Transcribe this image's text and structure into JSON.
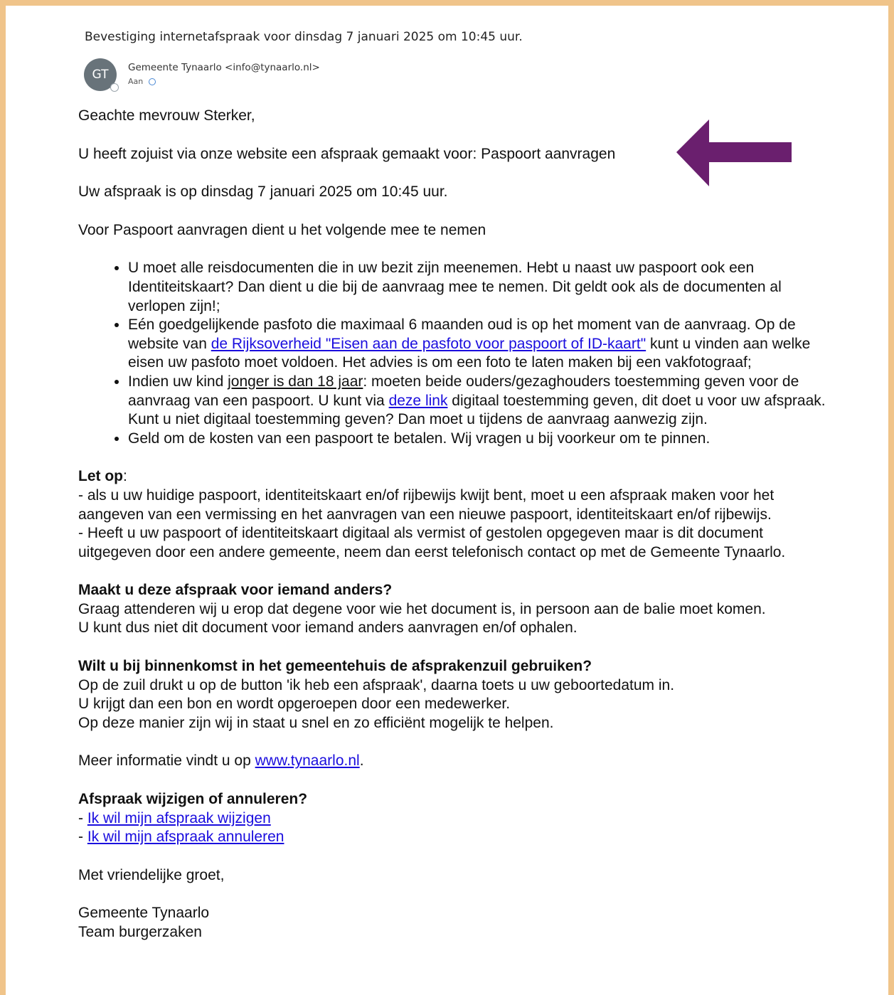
{
  "email": {
    "subject": "Bevestiging internetafspraak voor dinsdag 7 januari 2025 om 10:45 uur.",
    "sender": {
      "initials": "GT",
      "display": "Gemeente Tynaarlo <info@tynaarlo.nl>"
    },
    "to_label": "Aan"
  },
  "body": {
    "salutation": "Geachte mevrouw Sterker,",
    "intro": "U heeft zojuist via onze website een afspraak gemaakt voor: Paspoort aanvragen",
    "appointment": "Uw afspraak is op dinsdag 7 januari 2025 om 10:45 uur.",
    "bring_intro": "Voor Paspoort aanvragen dient u het volgende mee te nemen",
    "bullet1": "U moet alle reisdocumenten die in uw bezit zijn meenemen. Hebt u naast uw paspoort ook een Identiteitskaart? Dan dient u die bij de aanvraag mee te nemen. Dit geldt ook als de documenten al verlopen zijn!;",
    "bullet2_a": "Eén goedgelijkende pasfoto die maximaal 6 maanden oud is op het moment van de aanvraag. Op de website van ",
    "bullet2_link": "de Rijksoverheid \"Eisen aan de pasfoto voor paspoort of ID-kaart\"",
    "bullet2_b": " kunt u vinden aan welke eisen uw pasfoto moet voldoen. Het advies is om een foto te laten maken bij een vakfotograaf;",
    "bullet3_a": "Indien uw kind ",
    "bullet3_u": "jonger is dan 18 jaar",
    "bullet3_b": ": moeten beide ouders/gezaghouders toestemming geven voor de aanvraag van een paspoort. U kunt via ",
    "bullet3_link": "deze link",
    "bullet3_c": " digitaal toestemming geven, dit doet u voor uw afspraak. Kunt u niet digitaal toestemming geven? Dan moet u tijdens de aanvraag aanwezig zijn.",
    "bullet4": "Geld om de kosten van een paspoort te betalen. Wij vragen u bij voorkeur om  te pinnen.",
    "letop_heading": "Let op",
    "letop_colon": ":",
    "letop_1": "- als u uw huidige paspoort, identiteitskaart en/of rijbewijs kwijt bent, moet u een afspraak maken voor het aangeven van een vermissing en het aanvragen van een nieuwe paspoort, identiteitskaart en/of rijbewijs.",
    "letop_2": "- Heeft u uw paspoort of identiteitskaart digitaal als vermist of gestolen opgegeven maar is dit document uitgegeven door een andere gemeente, neem dan eerst telefonisch contact op met de Gemeente Tynaarlo.",
    "other_heading": "Maakt u deze afspraak voor iemand anders?",
    "other_1": "Graag attenderen wij u erop dat degene voor wie het document is, in persoon aan de balie moet komen.",
    "other_2": "U kunt dus niet dit document voor iemand anders aanvragen en/of ophalen.",
    "kiosk_heading": "Wilt u bij binnenkomst in het gemeentehuis de afsprakenzuil gebruiken?",
    "kiosk_1": "Op de zuil drukt u op de button 'ik heb een afspraak', daarna toets u uw geboortedatum in.",
    "kiosk_2": "U krijgt dan een bon en wordt opgeroepen door een medewerker.",
    "kiosk_3": "Op deze manier zijn wij in staat u snel en zo efficiënt mogelijk te helpen.",
    "more_info_a": "Meer informatie vindt u op ",
    "more_info_link": "www.tynaarlo.nl",
    "more_info_b": ".",
    "change_heading": "Afspraak wijzigen of annuleren?",
    "change_prefix": "- ",
    "change_link": "Ik wil mijn afspraak wijzigen",
    "cancel_link": "Ik wil mijn afspraak annuleren",
    "closing": "Met vriendelijke groet,",
    "sign_1": "Gemeente Tynaarlo",
    "sign_2": "Team burgerzaken"
  },
  "colors": {
    "page_border": "#f0c48a",
    "link": "#1a0dde",
    "arrow": "#6a1f6e",
    "avatar": "#68737a"
  }
}
